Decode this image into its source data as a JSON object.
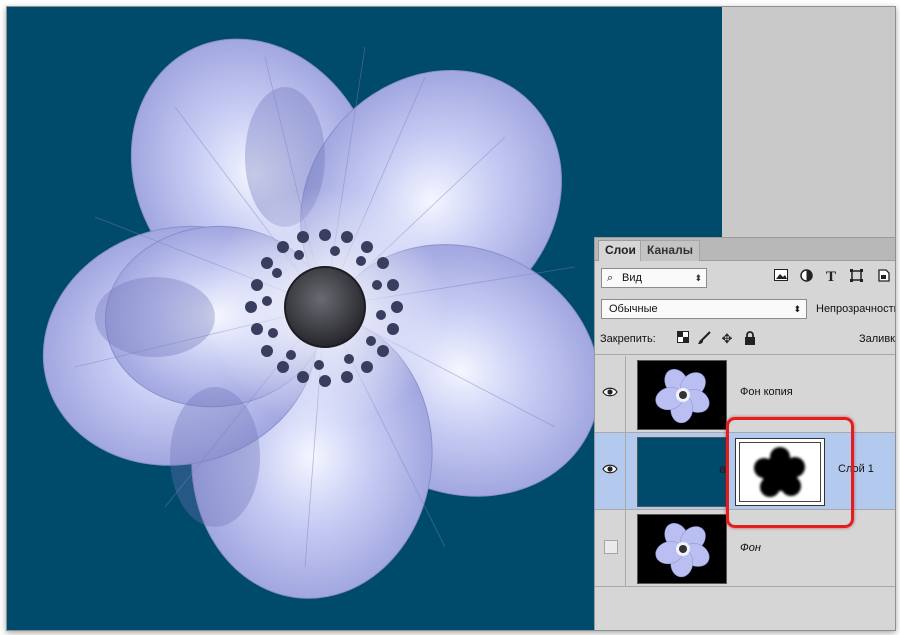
{
  "panel": {
    "tabs": [
      {
        "label": "Слои",
        "active": true
      },
      {
        "label": "Каналы",
        "active": false
      }
    ],
    "filter": {
      "label": "Вид",
      "icon": "search-icon"
    },
    "filter_icons": [
      "image-filter-icon",
      "adjustment-filter-icon",
      "type-filter-icon",
      "shape-filter-icon",
      "smart-object-filter-icon"
    ],
    "blend_mode": "Обычные",
    "opacity_label": "Непрозрачность",
    "lock_label": "Закрепить:",
    "lock_icons": [
      "lock-transparent-icon",
      "lock-image-icon",
      "lock-position-icon",
      "lock-all-icon"
    ],
    "fill_label": "Заливка",
    "layers": [
      {
        "name": "Фон копия",
        "visible": true,
        "selected": false,
        "thumbnail": "flower"
      },
      {
        "name": "Слой 1",
        "visible": true,
        "selected": true,
        "thumbnail": "solid-color",
        "has_mask": true
      },
      {
        "name": "Фон",
        "visible": false,
        "selected": false,
        "thumbnail": "flower",
        "italic": true
      }
    ]
  },
  "colors": {
    "canvas_background": "#004a6c",
    "selected_layer": "#b4c9ee",
    "highlight": "#e02020"
  }
}
